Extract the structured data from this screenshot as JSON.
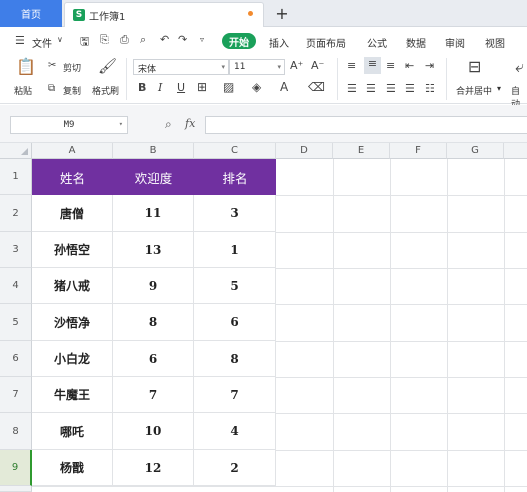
{
  "tabs": {
    "home_label": "首页",
    "doc_label": "工作簿1",
    "doc_icon": "S",
    "add_label": "+"
  },
  "menu": {
    "file_label": "文件",
    "start_label": "开始",
    "items": [
      "插入",
      "页面布局",
      "公式",
      "数据",
      "审阅",
      "视图"
    ]
  },
  "ribbon": {
    "paste_label": "粘贴",
    "cut_label": "剪切",
    "copy_label": "复制",
    "format_painter_label": "格式刷",
    "font_name": "宋体",
    "font_size": "11",
    "bold_label": "B",
    "italic_label": "I",
    "underline_label": "U",
    "merge_label": "合并居中",
    "auto_wrap_label": "自动"
  },
  "formula_bar": {
    "cell_ref": "M9",
    "fx_label": "fx",
    "formula_value": ""
  },
  "sheet": {
    "columns": [
      "A",
      "B",
      "C",
      "D",
      "E",
      "F",
      "G"
    ],
    "row_numbers": [
      "1",
      "2",
      "3",
      "4",
      "5",
      "6",
      "7",
      "8",
      "9"
    ],
    "active_row": "9",
    "header": [
      "姓名",
      "欢迎度",
      "排名"
    ],
    "rows": [
      [
        "唐僧",
        "11",
        "3"
      ],
      [
        "孙悟空",
        "13",
        "1"
      ],
      [
        "猪八戒",
        "9",
        "5"
      ],
      [
        "沙悟净",
        "8",
        "6"
      ],
      [
        "小白龙",
        "6",
        "8"
      ],
      [
        "牛魔王",
        "7",
        "7"
      ],
      [
        "哪吒",
        "10",
        "4"
      ],
      [
        "杨戬",
        "12",
        "2"
      ]
    ],
    "header_color": "#7030a0"
  }
}
